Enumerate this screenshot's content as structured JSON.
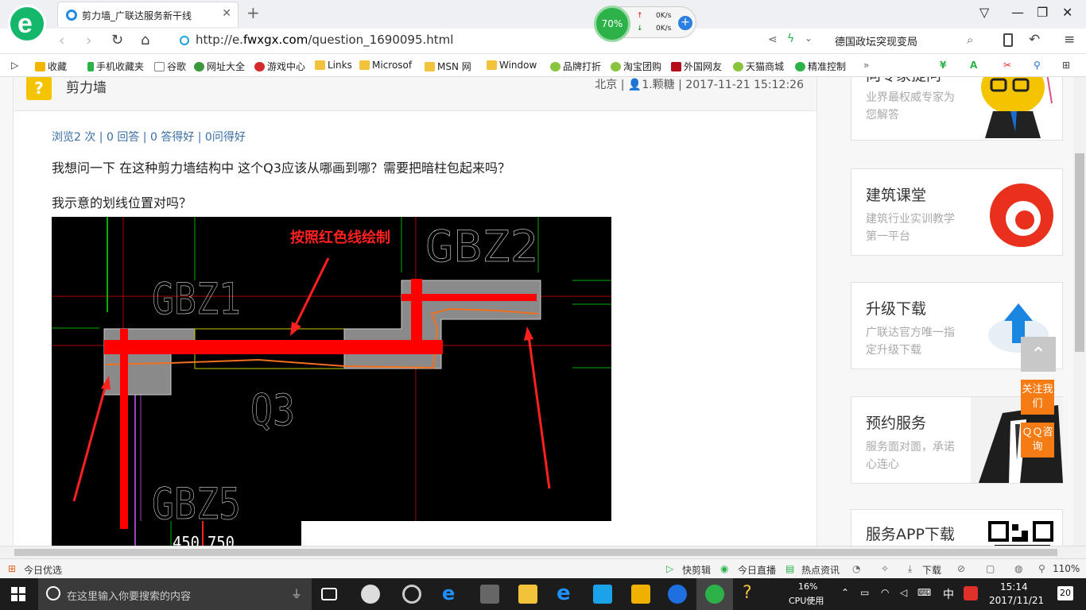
{
  "browser": {
    "tab_title": "剪力墙_广联达服务新干线",
    "url_prefix": "http://e.",
    "url_domain": "fwxgx.com",
    "url_path": "/question_1690095.html",
    "search_text": "德国政坛突现变局",
    "perf": {
      "percent": "70%",
      "up": "0K/s",
      "down": "0K/s"
    }
  },
  "favorites": [
    "收藏",
    "手机收藏夹",
    "谷歌",
    "网址大全",
    "游戏中心",
    "Links",
    "Microsof",
    "MSN 网",
    "Window",
    "品牌打折",
    "淘宝团购",
    "外国网友",
    "天猫商城",
    "精准控制"
  ],
  "question": {
    "icon": "?",
    "title": "剪力墙",
    "location": "北京",
    "user": "1.颗糖",
    "datetime": "2017-11-21 15:12:26",
    "stats": "浏览2 次 | 0 回答 | 0 答得好 | 0问得好",
    "body_line1": "我想问一下  在这种剪力墙结构中  这个Q3应该从哪画到哪？需要把暗柱包起来吗？",
    "body_line2": "我示意的划线位置对吗？"
  },
  "cad": {
    "annotation": "按照红色线绘制",
    "labels": [
      "GBZ2",
      "GBZ1",
      "Q3",
      "GBZ5"
    ],
    "dims": [
      "450",
      "750"
    ]
  },
  "sidebar": [
    {
      "title": "向专家提问",
      "desc": "业界最权威专家为您解答"
    },
    {
      "title": "建筑课堂",
      "desc": "建筑行业实训教学第一平台"
    },
    {
      "title": "升级下载",
      "desc": "广联达官方唯一指定升级下载"
    },
    {
      "title": "预约服务",
      "desc": "服务面对面，承诺心连心"
    },
    {
      "title": "服务APP下载",
      "desc": ""
    }
  ],
  "float": {
    "follow": "关注我们",
    "qq": "ＱＱ咨询"
  },
  "status": {
    "left": "今日优选",
    "items": [
      "快剪辑",
      "今日直播",
      "热点资讯",
      "下载"
    ],
    "zoom": "110%"
  },
  "taskbar": {
    "search_placeholder": "在这里输入你要搜索的内容",
    "cpu_percent": "16%",
    "cpu_label": "CPU使用",
    "ime": "中",
    "time": "15:14",
    "date": "2017/11/21",
    "notif": "20"
  }
}
